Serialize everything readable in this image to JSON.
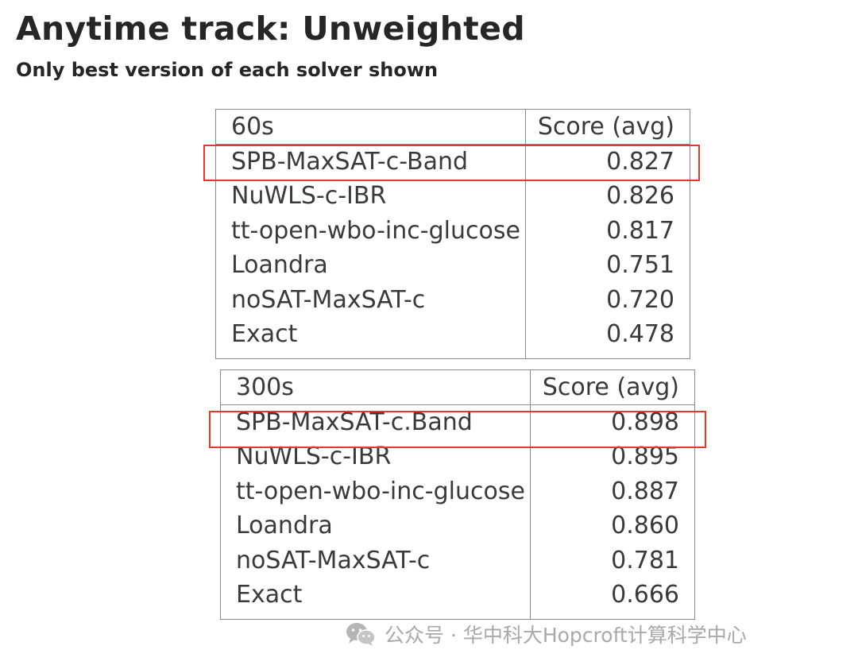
{
  "title": "Anytime track: Unweighted",
  "subtitle": "Only best version of each solver shown",
  "tables": [
    {
      "header": {
        "label": "60s",
        "score": "Score (avg)"
      },
      "rows": [
        {
          "name": "SPB-MaxSAT-c-Band",
          "score": "0.827"
        },
        {
          "name": "NuWLS-c-IBR",
          "score": "0.826"
        },
        {
          "name": "tt-open-wbo-inc-glucose",
          "score": "0.817"
        },
        {
          "name": "Loandra",
          "score": "0.751"
        },
        {
          "name": "noSAT-MaxSAT-c",
          "score": "0.720"
        },
        {
          "name": "Exact",
          "score": "0.478"
        }
      ]
    },
    {
      "header": {
        "label": "300s",
        "score": "Score (avg)"
      },
      "rows": [
        {
          "name": "SPB-MaxSAT-c.Band",
          "score": "0.898"
        },
        {
          "name": "NuWLS-c-IBR",
          "score": "0.895"
        },
        {
          "name": "tt-open-wbo-inc-glucose",
          "score": "0.887"
        },
        {
          "name": "Loandra",
          "score": "0.860"
        },
        {
          "name": "noSAT-MaxSAT-c",
          "score": "0.781"
        },
        {
          "name": "Exact",
          "score": "0.666"
        }
      ]
    }
  ],
  "highlight_color": "#e03a2f",
  "watermark": {
    "icon": "wechat-icon",
    "text": "公众号 · 华中科大Hopcroft计算科学中心"
  }
}
